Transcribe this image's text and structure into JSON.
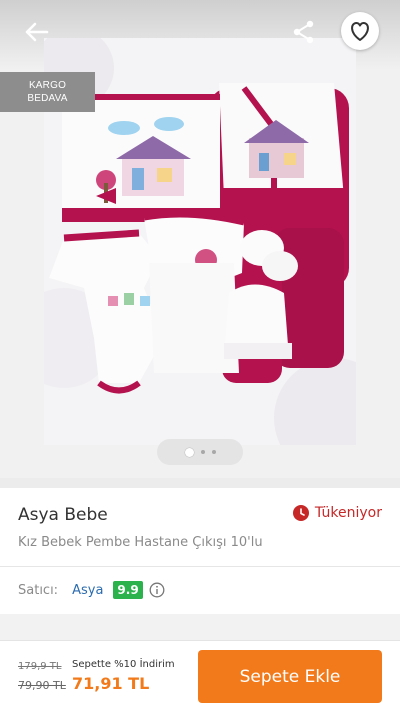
{
  "header": {
    "back_icon": "arrow-left-icon",
    "share_icon": "share-icon",
    "favorite_icon": "heart-outline-icon"
  },
  "badge": {
    "line1": "KARGO",
    "line2": "BEDAVA"
  },
  "gallery": {
    "page_count": 3,
    "active_index": 0
  },
  "product": {
    "brand": "Asya Bebe",
    "name": "Kız Bebek Pembe Hastane Çıkışı 10'lu",
    "stock_status": "Tükeniyor",
    "stock_icon": "clock-icon"
  },
  "seller": {
    "label": "Satıcı:",
    "name": "Asya",
    "score": "9.9",
    "info_icon": "info-icon"
  },
  "pricing": {
    "original_price": "179,9 TL",
    "sale_price": "79,90 TL",
    "cart_discount_label": "Sepette %10 İndirim",
    "final_price": "71,91 TL"
  },
  "actions": {
    "add_to_cart": "Sepete Ekle"
  },
  "colors": {
    "accent": "#f27a1a",
    "stock_red": "#c62828",
    "seller_score_green": "#2bb24c",
    "seller_link_blue": "#2b6cb0",
    "product_fuchsia": "#c2185b"
  }
}
